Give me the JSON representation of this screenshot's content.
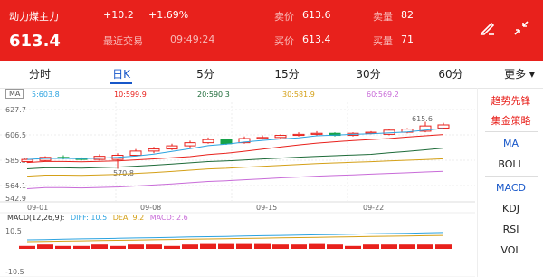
{
  "header": {
    "name": "动力煤主力",
    "price": "613.4",
    "change": "+10.2",
    "change_pct": "+1.69%",
    "last_trade_label": "最近交易",
    "last_trade_time": "09:49:24",
    "sell_price_label": "卖价",
    "sell_price": "613.6",
    "buy_price_label": "买价",
    "buy_price": "613.4",
    "sell_vol_label": "卖量",
    "sell_vol": "82",
    "buy_vol_label": "买量",
    "buy_vol": "71",
    "icons": [
      "edit-icon",
      "collapse-icon"
    ]
  },
  "tabs": [
    "分时",
    "日K",
    "5分",
    "15分",
    "30分",
    "60分",
    "更多"
  ],
  "active_tab": "日K",
  "ma_bar": {
    "tag": "MA",
    "ma5": "5:603.8",
    "ma10": "10:599.9",
    "ma20": "20:590.3",
    "ma30": "30:581.9",
    "ma60": "60:569.2"
  },
  "colors": {
    "up": "#e8211c",
    "down": "#16a34a",
    "ma5": "#2ca3e0",
    "ma10": "#e8211c",
    "ma20": "#1e6b39",
    "ma30": "#d4a017",
    "ma60": "#c86bd8",
    "accent": "#1757c9"
  },
  "side": {
    "strategy1": "趋势先锋",
    "strategy2": "集金策略",
    "indicators_top": [
      "MA",
      "BOLL"
    ],
    "indicators_bottom": [
      "MACD",
      "KDJ",
      "RSI",
      "VOL"
    ]
  },
  "chart": {
    "y_labels": [
      "627.7",
      "606.5",
      "585.3",
      "564.1",
      "542.9"
    ],
    "x_labels": [
      "09-01",
      "09-08",
      "09-15",
      "09-22"
    ],
    "annotations": {
      "high": "615.6",
      "low": "570.8"
    },
    "macd_labels": {
      "top": "10.5",
      "bottom": "-10.5"
    }
  },
  "macd": {
    "title": "MACD(12,26,9):",
    "diff": "DIFF: 10.5",
    "dea": "DEA: 9.2",
    "macd": "MACD: 2.6"
  },
  "chart_data": {
    "type": "candlestick",
    "y_range": [
      542.9,
      627.7
    ],
    "candles": [
      {
        "o": 578,
        "c": 580,
        "h": 581,
        "l": 577
      },
      {
        "o": 579,
        "c": 582,
        "h": 583,
        "l": 578
      },
      {
        "o": 582,
        "c": 581,
        "h": 584,
        "l": 580
      },
      {
        "o": 581,
        "c": 580,
        "h": 582,
        "l": 579
      },
      {
        "o": 580,
        "c": 583,
        "h": 585,
        "l": 579
      },
      {
        "o": 580,
        "c": 584,
        "h": 586,
        "l": 571
      },
      {
        "o": 584,
        "c": 588,
        "h": 590,
        "l": 583
      },
      {
        "o": 588,
        "c": 590,
        "h": 592,
        "l": 586
      },
      {
        "o": 590,
        "c": 593,
        "h": 595,
        "l": 589
      },
      {
        "o": 593,
        "c": 596,
        "h": 598,
        "l": 591
      },
      {
        "o": 596,
        "c": 599,
        "h": 601,
        "l": 595
      },
      {
        "o": 599,
        "c": 595,
        "h": 600,
        "l": 594
      },
      {
        "o": 596,
        "c": 600,
        "h": 602,
        "l": 595
      },
      {
        "o": 600,
        "c": 601,
        "h": 603,
        "l": 599
      },
      {
        "o": 601,
        "c": 603,
        "h": 604,
        "l": 600
      },
      {
        "o": 603,
        "c": 604,
        "h": 606,
        "l": 602
      },
      {
        "o": 604,
        "c": 605,
        "h": 607,
        "l": 603
      },
      {
        "o": 605,
        "c": 603,
        "h": 606,
        "l": 602
      },
      {
        "o": 603,
        "c": 605,
        "h": 606,
        "l": 602
      },
      {
        "o": 605,
        "c": 606,
        "h": 607,
        "l": 604
      },
      {
        "o": 604,
        "c": 608,
        "h": 609,
        "l": 603
      },
      {
        "o": 606,
        "c": 609,
        "h": 610,
        "l": 605
      },
      {
        "o": 607,
        "c": 612,
        "h": 616,
        "l": 606
      },
      {
        "o": 610,
        "c": 613,
        "h": 615,
        "l": 609
      }
    ],
    "macd_hist": [
      2,
      3,
      2,
      2,
      3,
      2,
      3,
      3,
      2,
      3,
      4,
      4,
      4,
      4,
      3,
      3,
      4,
      3,
      2,
      3,
      3,
      3,
      3,
      3
    ]
  }
}
